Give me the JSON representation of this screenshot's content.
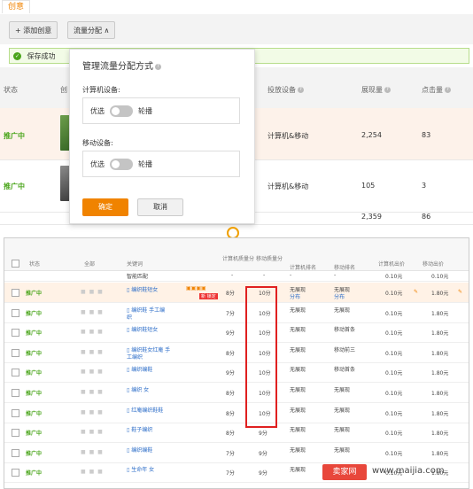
{
  "top": {
    "tab_label": "创意",
    "add_button": "+ 添加创意",
    "traffic_button": "流量分配 ∧",
    "save_banner": "保存成功",
    "headers": {
      "status": "状态",
      "creative": "创",
      "device": "投放设备",
      "impressions": "展现量",
      "clicks": "点击量"
    },
    "rows": [
      {
        "status": "推广中",
        "device": "计算机&移动",
        "impressions": "2,254",
        "clicks": "83"
      },
      {
        "status": "推广中",
        "device": "计算机&移动",
        "impressions": "105",
        "clicks": "3"
      }
    ],
    "totals": {
      "impressions": "2,359",
      "clicks": "86"
    }
  },
  "popup": {
    "title": "管理流量分配方式",
    "pc_label": "计算机设备:",
    "mobile_label": "移动设备:",
    "pref": "优选",
    "rotate": "轮播",
    "confirm": "确定",
    "cancel": "取消"
  },
  "bottom": {
    "headers": {
      "status": "状态",
      "all": "全部",
      "keyword": "关键词",
      "pc_score": "计算机质量分",
      "mobile_score": "移动质量分",
      "pc_rank": "计算机排名",
      "mobile_rank": "移动排名",
      "pc_bid": "计算机出价",
      "mobile_bid": "移动出价"
    },
    "smart_label": "智能匹配",
    "smart_pc_bid": "0.10元",
    "smart_mobile_bid": "0.10元",
    "dash": "-",
    "rows": [
      {
        "status": "推广中",
        "keyword": "编织鞋短女",
        "kw2": "",
        "pc": "8分",
        "mob": "10分",
        "pcrank": "无展现",
        "pcrank2": "分布",
        "mobrank": "无展现",
        "mobrank2": "分布",
        "pcbid": "0.10元",
        "mobbid": "1.80元"
      },
      {
        "status": "推广中",
        "keyword": "编织鞋 手工编",
        "kw2": "织",
        "pc": "7分",
        "mob": "10分",
        "pcrank": "无展现",
        "pcrank2": "",
        "mobrank": "无展现",
        "mobrank2": "",
        "pcbid": "0.10元",
        "mobbid": "1.80元"
      },
      {
        "status": "推广中",
        "keyword": "编织鞋短女",
        "kw2": "",
        "pc": "9分",
        "mob": "10分",
        "pcrank": "无展现",
        "pcrank2": "",
        "mobrank": "移动首条",
        "mobrank2": "",
        "pcbid": "0.10元",
        "mobbid": "1.80元"
      },
      {
        "status": "推广中",
        "keyword": "编织鞋女红庵 手",
        "kw2": "工编织",
        "pc": "8分",
        "mob": "10分",
        "pcrank": "无展现",
        "pcrank2": "",
        "mobrank": "移动前三",
        "mobrank2": "",
        "pcbid": "0.10元",
        "mobbid": "1.80元"
      },
      {
        "status": "推广中",
        "keyword": "编织编鞋",
        "kw2": "",
        "pc": "9分",
        "mob": "10分",
        "pcrank": "无展现",
        "pcrank2": "",
        "mobrank": "移动首条",
        "mobrank2": "",
        "pcbid": "0.10元",
        "mobbid": "1.80元"
      },
      {
        "status": "推广中",
        "keyword": "编织 女",
        "kw2": "",
        "pc": "8分",
        "mob": "10分",
        "pcrank": "无展现",
        "pcrank2": "",
        "mobrank": "无展现",
        "mobrank2": "",
        "pcbid": "0.10元",
        "mobbid": "1.80元"
      },
      {
        "status": "推广中",
        "keyword": "红庵编织鞋鞋",
        "kw2": "",
        "pc": "8分",
        "mob": "10分",
        "pcrank": "无展现",
        "pcrank2": "",
        "mobrank": "无展现",
        "mobrank2": "",
        "pcbid": "0.10元",
        "mobbid": "1.80元"
      },
      {
        "status": "推广中",
        "keyword": "鞋子编织",
        "kw2": "",
        "pc": "8分",
        "mob": "9分",
        "pcrank": "无展现",
        "pcrank2": "",
        "mobrank": "无展现",
        "mobrank2": "",
        "pcbid": "0.10元",
        "mobbid": "1.80元"
      },
      {
        "status": "推广中",
        "keyword": "编织编鞋",
        "kw2": "",
        "pc": "7分",
        "mob": "9分",
        "pcrank": "无展现",
        "pcrank2": "",
        "mobrank": "无展现",
        "mobrank2": "",
        "pcbid": "0.10元",
        "mobbid": "1.80元"
      },
      {
        "status": "推广中",
        "keyword": "生命年 女",
        "kw2": "",
        "pc": "7分",
        "mob": "9分",
        "pcrank": "无展现",
        "pcrank2": "",
        "mobrank": "无展现",
        "mobrank2": "",
        "pcbid": "0.10元",
        "mobbid": "1.80元"
      }
    ],
    "badge_text": "新 锁定"
  },
  "watermark": {
    "brand": "卖家网",
    "url": "www.maijia.com"
  },
  "colors": {
    "orange": "#f08300",
    "green": "#4aa51b",
    "link": "#2f6fc9",
    "red": "#e02020"
  }
}
